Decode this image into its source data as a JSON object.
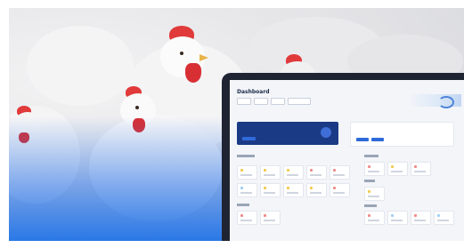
{
  "app": {
    "breadcrumb": "",
    "title": "Dashboard"
  },
  "colors": {
    "brand_blue": "#2a78e6",
    "navy": "#1b3a85",
    "comb_red": "#e03a3a"
  },
  "tile_dot_colors": [
    "#f2c94c",
    "#f2c94c",
    "#f08a8a",
    "#f08a8a",
    "#9ed0f5",
    "#f2c94c"
  ]
}
